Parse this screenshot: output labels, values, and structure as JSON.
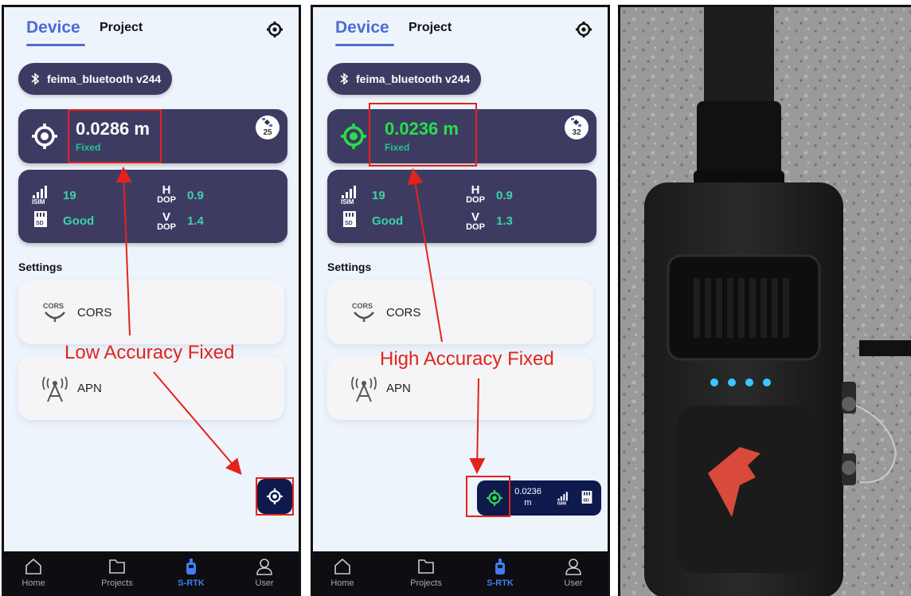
{
  "screens": [
    {
      "tabs": {
        "device": "Device",
        "project": "Project"
      },
      "bluetooth": {
        "label": "feima_bluetooth v244"
      },
      "accuracy": {
        "value": "0.0286 m",
        "status": "Fixed",
        "satellites": "25"
      },
      "stats": {
        "sim": "19",
        "sd": "Good",
        "hdop_label_top": "H",
        "hdop_label_bottom": "DOP",
        "hdop": "0.9",
        "vdop_label_top": "V",
        "vdop_label_bottom": "DOP",
        "vdop": "1.4"
      },
      "settings": {
        "title": "Settings",
        "cors_icon_text": "CORS",
        "cors_label": "CORS",
        "apn_label": "APN"
      },
      "annotation": "Low Accuracy Fixed",
      "nav": [
        "Home",
        "Projects",
        "S-RTK",
        "User"
      ]
    },
    {
      "tabs": {
        "device": "Device",
        "project": "Project"
      },
      "bluetooth": {
        "label": "feima_bluetooth v244"
      },
      "accuracy": {
        "value": "0.0236 m",
        "status": "Fixed",
        "satellites": "32"
      },
      "stats": {
        "sim": "19",
        "sd": "Good",
        "hdop_label_top": "H",
        "hdop_label_bottom": "DOP",
        "hdop": "0.9",
        "vdop_label_top": "V",
        "vdop_label_bottom": "DOP",
        "vdop": "1.3"
      },
      "settings": {
        "title": "Settings",
        "cors_icon_text": "CORS",
        "cors_label": "CORS",
        "apn_label": "APN"
      },
      "annotation": "High Accuracy Fixed",
      "mini_bar": {
        "value_line1": "0.0236",
        "value_line2": "m"
      },
      "nav": [
        "Home",
        "Projects",
        "S-RTK",
        "User"
      ]
    }
  ],
  "photo": {
    "description_icon": "rtk-receiver-photo"
  },
  "colors": {
    "accent": "#4d6ad6",
    "card": "#3e3b63",
    "fixed_green": "#27e04a",
    "status_teal": "#22c38e",
    "annotation_red": "#e3231b",
    "nav_bg": "#0d0d12",
    "nav_active": "#3f7ff2"
  }
}
